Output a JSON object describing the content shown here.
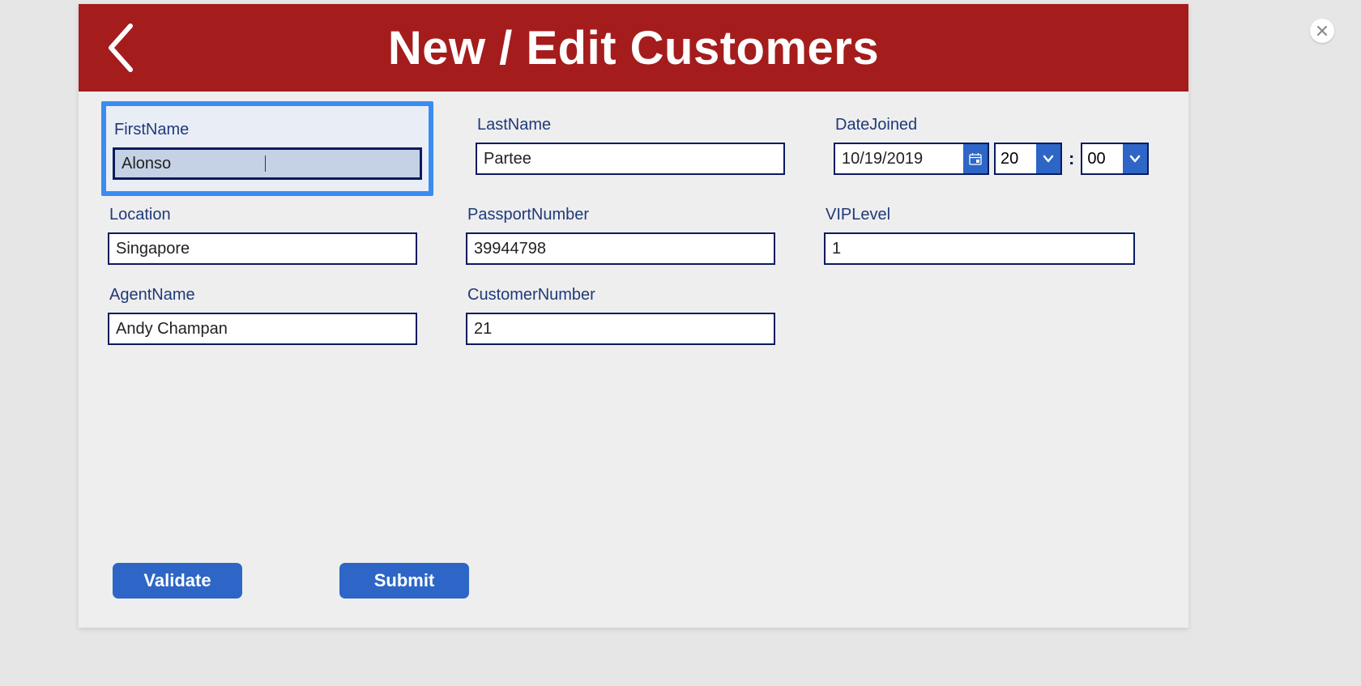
{
  "header": {
    "title": "New / Edit Customers"
  },
  "form": {
    "firstName": {
      "label": "FirstName",
      "value": "Alonso"
    },
    "lastName": {
      "label": "LastName",
      "value": "Partee"
    },
    "dateJoined": {
      "label": "DateJoined",
      "date": "10/19/2019",
      "hour": "20",
      "minute": "00",
      "sep": ":"
    },
    "location": {
      "label": "Location",
      "value": "Singapore"
    },
    "passportNumber": {
      "label": "PassportNumber",
      "value": "39944798"
    },
    "vipLevel": {
      "label": "VIPLevel",
      "value": "1"
    },
    "agentName": {
      "label": "AgentName",
      "value": "Andy Champan"
    },
    "customerNumber": {
      "label": "CustomerNumber",
      "value": "21"
    }
  },
  "buttons": {
    "validate": "Validate",
    "submit": "Submit"
  }
}
